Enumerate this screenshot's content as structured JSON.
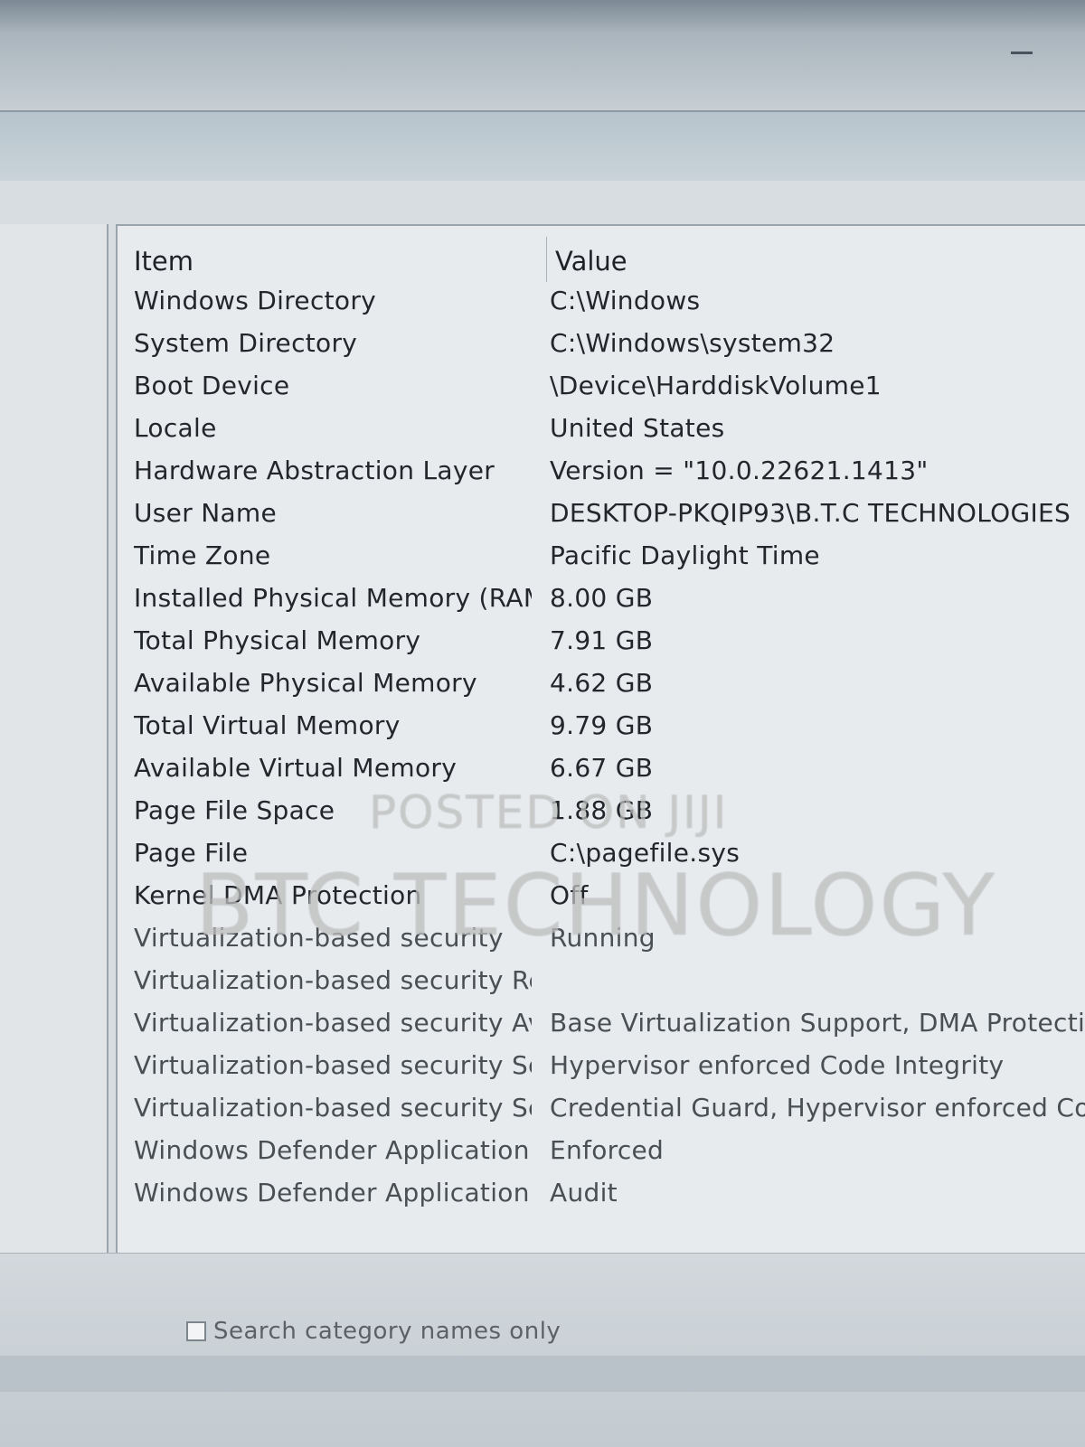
{
  "window": {
    "minimize_icon": "minimize-icon"
  },
  "list": {
    "header_item": "Item",
    "header_value": "Value",
    "rows": [
      {
        "item": "Windows Directory",
        "value": "C:\\Windows"
      },
      {
        "item": "System Directory",
        "value": "C:\\Windows\\system32"
      },
      {
        "item": "Boot Device",
        "value": "\\Device\\HarddiskVolume1"
      },
      {
        "item": "Locale",
        "value": "United States"
      },
      {
        "item": "Hardware Abstraction Layer",
        "value": "Version = \"10.0.22621.1413\""
      },
      {
        "item": "User Name",
        "value": "DESKTOP-PKQIP93\\B.T.C TECHNOLOGIES"
      },
      {
        "item": "Time Zone",
        "value": "Pacific Daylight Time"
      },
      {
        "item": "Installed Physical Memory (RAM)",
        "value": "8.00 GB"
      },
      {
        "item": "Total Physical Memory",
        "value": "7.91 GB"
      },
      {
        "item": "Available Physical Memory",
        "value": "4.62 GB"
      },
      {
        "item": "Total Virtual Memory",
        "value": "9.79 GB"
      },
      {
        "item": "Available Virtual Memory",
        "value": "6.67 GB"
      },
      {
        "item": "Page File Space",
        "value": "1.88 GB"
      },
      {
        "item": "Page File",
        "value": "C:\\pagefile.sys"
      },
      {
        "item": "Kernel DMA Protection",
        "value": "Off"
      },
      {
        "item": "Virtualization-based security",
        "value": "Running"
      },
      {
        "item": "Virtualization-based security Re...",
        "value": ""
      },
      {
        "item": "Virtualization-based security Av...",
        "value": "Base Virtualization Support, DMA Protection,"
      },
      {
        "item": "Virtualization-based security Se...",
        "value": "Hypervisor enforced Code Integrity"
      },
      {
        "item": "Virtualization-based security Se...",
        "value": "Credential Guard, Hypervisor enforced Code"
      },
      {
        "item": "Windows Defender Application...",
        "value": "Enforced"
      },
      {
        "item": "Windows Defender Application...",
        "value": "Audit"
      }
    ]
  },
  "search": {
    "checkbox_label": "Search category names only",
    "checked": false
  },
  "watermark": {
    "line1": "POSTED ON JIJI",
    "line2": "BTC TECHNOLOGY"
  }
}
